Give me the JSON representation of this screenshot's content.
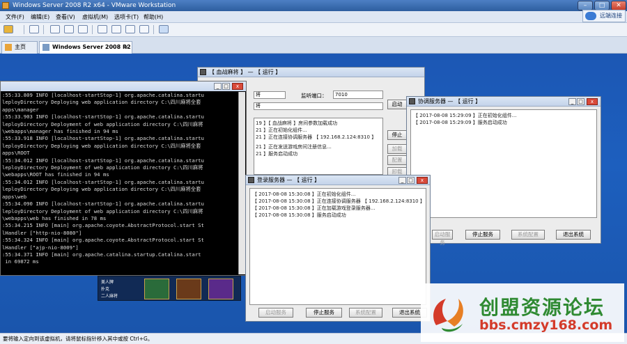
{
  "titlebar": {
    "title": "Windows Server 2008 R2 x64 - VMware Workstation",
    "minimize": "–",
    "maximize": "□",
    "close": "✕"
  },
  "connect": {
    "label": "远端连接"
  },
  "menu": [
    "文件(F)",
    "编辑(E)",
    "查看(V)",
    "虚拟机(M)",
    "选项卡(T)",
    "帮助(H)"
  ],
  "tabs": [
    {
      "label": "主页"
    },
    {
      "label": "Windows Server 2008 R2 ..."
    }
  ],
  "tab_close": "×",
  "console": {
    "lines": [
      ":55:33.809 INFO [localhost-startStop-1] org.apache.catalina.startu",
      "leployDirectory Deploying web application directory C:\\四川麻将全套",
      "apps\\manager",
      ":55:33.903 INFO [localhost-startStop-1] org.apache.catalina.startu",
      "leployDirectory Deployment of web application directory C:\\四川麻将",
      "\\webapps\\manager has finished in 94 ms",
      ":55:33.918 INFO [localhost-startStop-1] org.apache.catalina.startu",
      "leployDirectory Deploying web application directory C:\\四川麻将全套",
      "apps\\ROOT",
      ":55:34.012 INFO [localhost-startStop-1] org.apache.catalina.startu",
      "leployDirectory Deployment of web application directory C:\\四川麻将",
      "\\webapps\\ROOT has finished in 94 ms",
      ":55:34.012 INFO [localhost-startStop-1] org.apache.catalina.startu",
      "leployDirectory Deploying web application directory C:\\四川麻将全套",
      "apps\\web",
      ":55:34.090 INFO [localhost-startStop-1] org.apache.catalina.startu",
      "leployDirectory Deployment of web application directory C:\\四川麻将",
      "\\webapps\\web has finished in 78 ms",
      ":55:34.215 INFO [main] org.apache.coyote.AbstractProtocol.start St",
      "lHandler [\"http-nio-8080\"]",
      ":55:34.324 INFO [main] org.apache.coyote.AbstractProtocol.start St",
      "lHandler [\"ajp-nio-8009\"]",
      ":55:34.371 INFO [main] org.apache.catalina.startup.Catalina.start",
      " in 69872 ms"
    ]
  },
  "blood_war": {
    "title": "【 血战麻将 】 — 【 运行 】",
    "field1": "将",
    "port_label": "监听端口：",
    "port_value": "7010",
    "field2": "将",
    "logs": [
      "19 】【 血战麻将 】房间参数加载成功",
      "21 】正在初始化组件...",
      "21 】正在连接协调服务器 【 192.168.2.124:8310 】",
      "21 】正在发送游戏房间注册信息...",
      "21 】服务启动成功"
    ],
    "buttons": [
      "启动",
      "停止",
      "加载",
      "配置",
      "卸载"
    ]
  },
  "coordinator": {
    "title": "协调服务器 — 【 运行 】",
    "logs": [
      "【 2017-08-08 15:29:09 】正在初始化组件...",
      "【 2017-08-08 15:29:09 】服务启动成功"
    ],
    "buttons": [
      "启动服务",
      "停止服务",
      "系统配置",
      "退出系统"
    ]
  },
  "login": {
    "title": "登录服务器 — 【 运行 】",
    "logs": [
      "【 2017-08-08 15:30:08 】正在初始化组件...",
      "【 2017-08-08 15:30:08 】正在连接协调服务器 【 192.168.2.124:8310 】",
      "【 2017-08-08 15:30:08 】正在加载游戏登录服务器...",
      "【 2017-08-08 15:30:08 】服务启动成功"
    ],
    "buttons": [
      "启动服务",
      "停止服务",
      "系统配置",
      "退出系统"
    ]
  },
  "game": {
    "items": [
      "美人牌",
      "扑克",
      "二人麻将"
    ]
  },
  "statusbar": {
    "text": "要将输入定向到该虚拟机，请将鼠标指针移入其中或按 Ctrl+G。"
  },
  "watermark": {
    "title": "创盟资源论坛",
    "url": "bbs.cmzy168.com"
  }
}
